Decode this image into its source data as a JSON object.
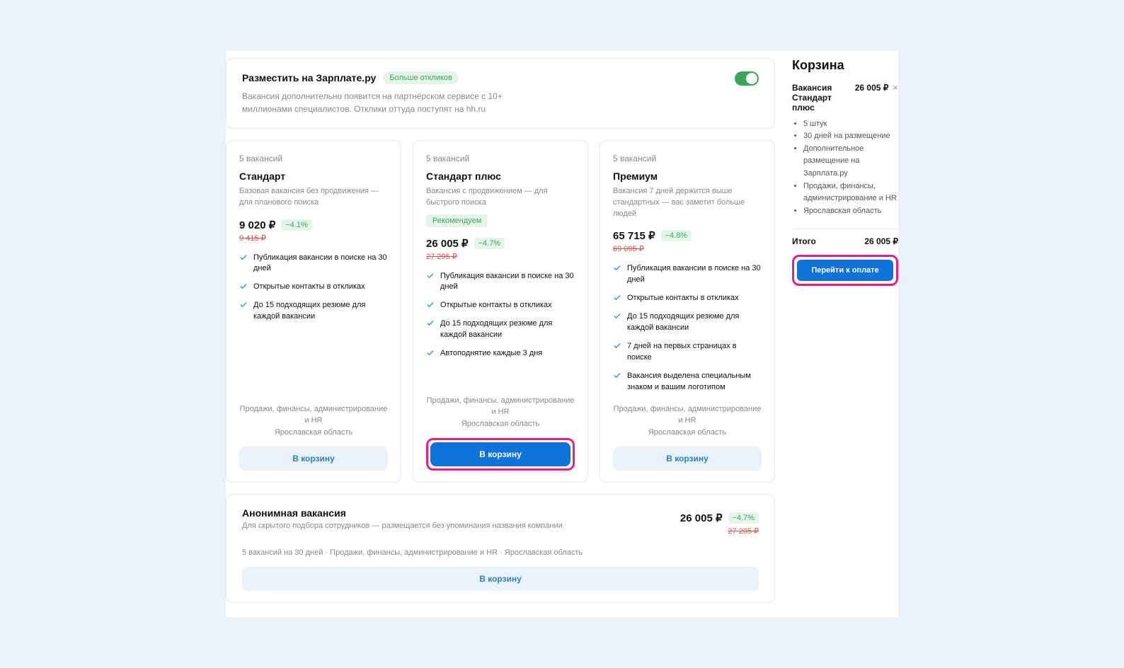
{
  "promo": {
    "title": "Разместить на Зарплате.ру",
    "badge": "Больше откликов",
    "desc": "Вакансия дополнительно появится на партнёрском сервисе с 10+ миллионами специалистов. Отклики оттуда поступят на hh.ru"
  },
  "plans": [
    {
      "count": "5 вакансий",
      "name": "Стандарт",
      "desc": "Базовая вакансия без продвижения — для планового поиска",
      "reco": null,
      "price": "9 020 ₽",
      "discount": "−4.1%",
      "old": "9 415 ₽",
      "features": [
        "Публикация вакансии в поиске на 30 дней",
        "Открытые контакты в откликах",
        "До 15 подходящих резюме для каждой вакансии"
      ],
      "meta1": "Продажи, финансы, администрирование и HR",
      "meta2": "Ярославская область",
      "button": "В корзину",
      "primary": false,
      "highlight": false
    },
    {
      "count": "5 вакансий",
      "name": "Стандарт плюс",
      "desc": "Вакансия с продвижением — для быстрого поиска",
      "reco": "Рекомендуем",
      "price": "26 005 ₽",
      "discount": "−4.7%",
      "old": "27 295 ₽",
      "features": [
        "Публикация вакансии в поиске на 30 дней",
        "Открытые контакты в откликах",
        "До 15 подходящих резюме для каждой вакансии",
        "Автоподнятие каждые 3 дня"
      ],
      "meta1": "Продажи, финансы, администрирование и HR",
      "meta2": "Ярославская область",
      "button": "В корзину",
      "primary": true,
      "highlight": true
    },
    {
      "count": "5 вакансий",
      "name": "Премиум",
      "desc": "Вакансия 7 дней держится выше стандартных — вас заметит больше людей",
      "reco": null,
      "price": "65 715 ₽",
      "discount": "−4.8%",
      "old": "69 095 ₽",
      "features": [
        "Публикация вакансии в поиске на 30 дней",
        "Открытые контакты в откликах",
        "До 15 подходящих резюме для каждой вакансии",
        "7 дней на первых страницах в поиске",
        "Вакансия выделена специальным знаком и вашим логотипом"
      ],
      "meta1": "Продажи, финансы, администрирование и HR",
      "meta2": "Ярославская область",
      "button": "В корзину",
      "primary": false,
      "highlight": false
    }
  ],
  "anon": {
    "title": "Анонимная вакансия",
    "desc": "Для скрытого подбора сотрудников — размещается без упоминания названия компании",
    "price": "26 005 ₽",
    "discount": "−4.7%",
    "old": "27 295 ₽",
    "meta": "5 вакансий на 30 дней · Продажи, финансы, администрирование и HR · Ярославская область",
    "button": "В корзину"
  },
  "cart": {
    "title": "Корзина",
    "item_name": "Вакансия Стандарт плюс",
    "item_price": "26 005 ₽",
    "details": [
      "5 штук",
      "30 дней на размещение",
      "Дополнительное размещение на Зарплата.ру",
      "Продажи, финансы, администрирование и HR",
      "Ярославская область"
    ],
    "total_label": "Итого",
    "total_value": "26 005 ₽",
    "pay": "Перейти к оплате"
  }
}
